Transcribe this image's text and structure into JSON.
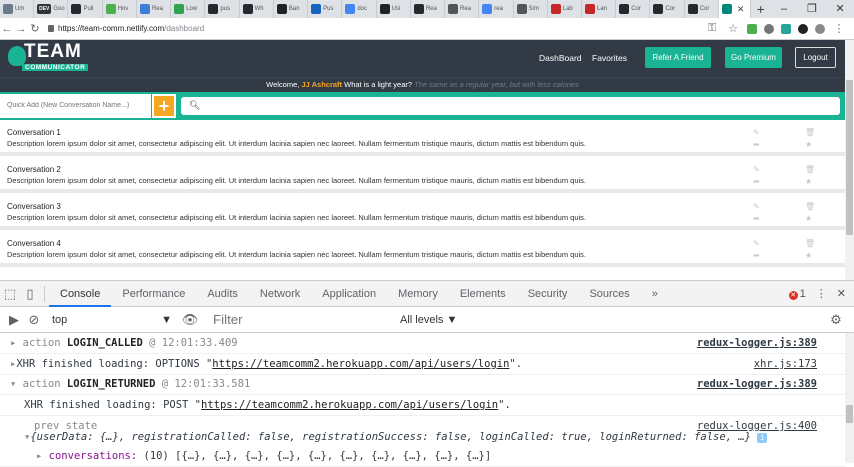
{
  "browser": {
    "tabs": [
      {
        "label": "Um",
        "color": "#6b7b8c"
      },
      {
        "label": "Goo",
        "color": "#333333",
        "badge": "DEV"
      },
      {
        "label": "Pull",
        "color": "#24292e"
      },
      {
        "label": "Hov",
        "color": "#4caf50"
      },
      {
        "label": "Rea",
        "color": "#3b7dd8"
      },
      {
        "label": "Low",
        "color": "#2ea44f"
      },
      {
        "label": "pus",
        "color": "#24292e"
      },
      {
        "label": "Wh",
        "color": "#24292e"
      },
      {
        "label": "Ban",
        "color": "#222222"
      },
      {
        "label": "Pus",
        "color": "#1565c0"
      },
      {
        "label": "doc",
        "color": "#4285f4"
      },
      {
        "label": "Usi",
        "color": "#222222"
      },
      {
        "label": "Rea",
        "color": "#24292e"
      },
      {
        "label": "Rea",
        "color": "#555555"
      },
      {
        "label": "rea",
        "color": "#4285f4"
      },
      {
        "label": "Sim",
        "color": "#555555"
      },
      {
        "label": "Lab",
        "color": "#c62828"
      },
      {
        "label": "Lan",
        "color": "#c62828"
      },
      {
        "label": "Cor",
        "color": "#24292e"
      },
      {
        "label": "Cor",
        "color": "#24292e"
      },
      {
        "label": "Cor",
        "color": "#24292e"
      },
      {
        "label": "",
        "color": "#00897b",
        "active": true
      }
    ],
    "url_host": "https://team-comm.netlify.com",
    "url_path": "/dashboard"
  },
  "app": {
    "logo_team": "TEAM",
    "logo_sub": "COMMUNICATOR",
    "nav": {
      "dashboard": "DashBoard",
      "favorites": "Favorites",
      "refer": "Refer A Friend",
      "premium": "Go Premium",
      "logout": "Logout"
    },
    "welcome": {
      "prefix": "Welcome,",
      "name": "JJ Ashcraft",
      "question": "What is a light year?",
      "answer": "The same as a regular year, but with less calories"
    },
    "quick_add_placeholder": "Quick Add (New Conversation Name...)",
    "quick_add_icon": "+",
    "conversations": [
      {
        "title": "Conversation 1",
        "description": "Description lorem ipsum dolor sit amet, consectetur adipiscing elit. Ut interdum lacinia sapien nec laoreet. Nullam fermentum tristique mauris, dictum mattis est bibendum quis."
      },
      {
        "title": "Conversation 2",
        "description": "Description lorem ipsum dolor sit amet, consectetur adipiscing elit. Ut interdum lacinia sapien nec laoreet. Nullam fermentum tristique mauris, dictum mattis est bibendum quis."
      },
      {
        "title": "Conversation 3",
        "description": "Description lorem ipsum dolor sit amet, consectetur adipiscing elit. Ut interdum lacinia sapien nec laoreet. Nullam fermentum tristique mauris, dictum mattis est bibendum quis."
      },
      {
        "title": "Conversation 4",
        "description": "Description lorem ipsum dolor sit amet, consectetur adipiscing elit. Ut interdum lacinia sapien nec laoreet. Nullam fermentum tristique mauris, dictum mattis est bibendum quis."
      }
    ]
  },
  "devtools": {
    "tabs": [
      "Console",
      "Performance",
      "Audits",
      "Network",
      "Application",
      "Memory",
      "Elements",
      "Security",
      "Sources"
    ],
    "active_tab": "Console",
    "more": "»",
    "error_count": "1",
    "context": "top",
    "filter_placeholder": "Filter",
    "levels": "All levels ▼",
    "log": [
      {
        "kind": "action",
        "prefix": "action",
        "name": "LOGIN_CALLED",
        "at": "@ 12:01:33.409",
        "src": "redux-logger.js:389",
        "collapsed": true
      },
      {
        "kind": "xhr",
        "text": "XHR finished loading: OPTIONS \"",
        "url": "https://teamcomm2.herokuapp.com/api/users/login",
        "end": "\".",
        "src": "xhr.js:173"
      },
      {
        "kind": "action",
        "prefix": "action",
        "name": "LOGIN_RETURNED",
        "at": "@ 12:01:33.581",
        "src": "redux-logger.js:389",
        "collapsed": false
      },
      {
        "kind": "xhr2",
        "text": "XHR finished loading: POST \"",
        "url": "https://teamcomm2.herokuapp.com/api/users/login",
        "end": "\"."
      },
      {
        "kind": "prev",
        "label": "prev state",
        "src": "redux-logger.js:400"
      },
      {
        "kind": "obj",
        "text": "{userData: {…}, registrationCalled: false, registrationSuccess: false, loginCalled: true, loginReturned: false, …}"
      },
      {
        "kind": "conv",
        "key": "conversations:",
        "value": "(10) [{…}, {…}, {…}, {…}, {…}, {…}, {…}, {…}, {…}, {…}]"
      }
    ]
  }
}
